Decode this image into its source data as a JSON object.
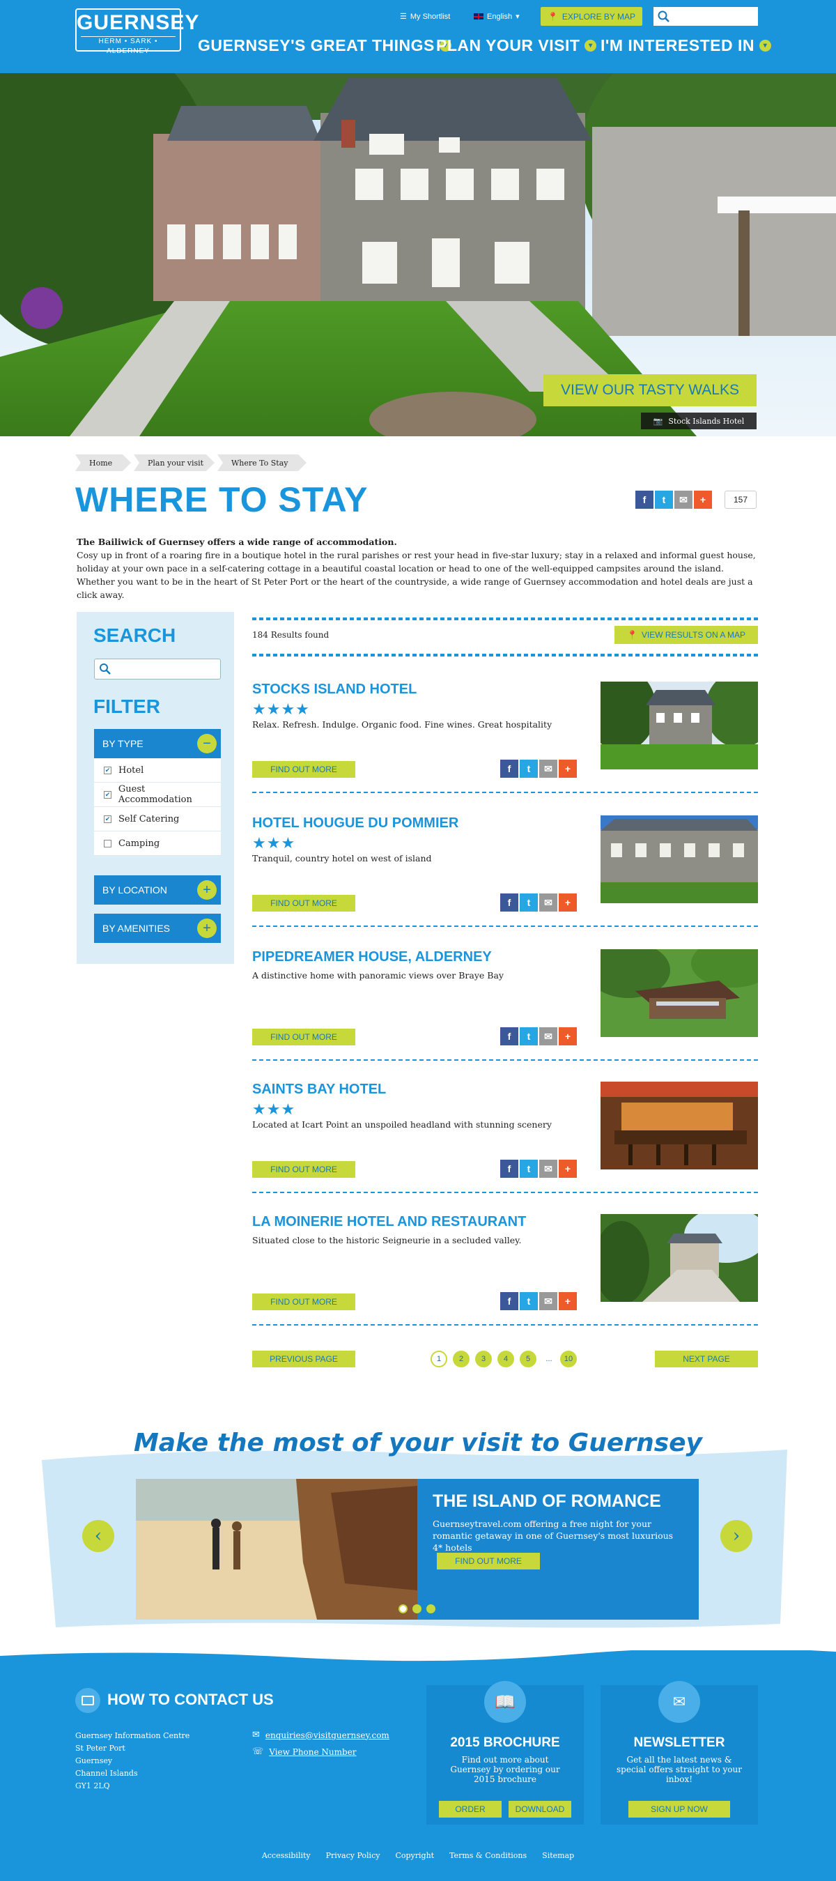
{
  "header": {
    "logo_main": "GUERNSEY",
    "logo_sub": "HERM • SARK • ALDERNEY",
    "shortlist": "My Shortlist",
    "language": "English",
    "explore": "EXPLORE BY MAP",
    "search_placeholder": "",
    "nav": [
      "GUERNSEY'S GREAT THINGS",
      "PLAN YOUR VISIT",
      "I'M INTERESTED IN"
    ]
  },
  "hero": {
    "cta": "VIEW OUR TASTY WALKS",
    "caption": "Stock Islands Hotel"
  },
  "breadcrumb": [
    "Home",
    "Plan your visit",
    "Where To Stay"
  ],
  "page": {
    "title": "WHERE TO STAY",
    "share_count": "157",
    "intro_bold": "The Bailiwick of Guernsey offers a wide range of accommodation.",
    "intro_text": "Cosy up in front of a roaring fire in a boutique hotel in the rural parishes or rest your head in five-star luxury; stay in a relaxed and informal guest house, holiday at your own pace in a self-catering cottage in a beautiful coastal location or head to one of the well-equipped campsites around the island. Whether you want to be in the heart of St Peter Port or the heart of the countryside, a wide range of Guernsey accommodation and hotel deals are just a click away."
  },
  "sidebar": {
    "search_heading": "SEARCH",
    "filter_heading": "FILTER",
    "by_type": "BY TYPE",
    "type_options": [
      {
        "label": "Hotel",
        "checked": true
      },
      {
        "label": "Guest Accommodation",
        "checked": true
      },
      {
        "label": "Self Catering",
        "checked": true
      },
      {
        "label": "Camping",
        "checked": false
      }
    ],
    "by_location": "BY LOCATION",
    "by_amenities": "BY AMENITIES"
  },
  "results": {
    "count_text": "184 Results found",
    "map_button": "VIEW RESULTS ON A MAP",
    "more_label": "FIND OUT MORE",
    "items": [
      {
        "name": "STOCKS ISLAND HOTEL",
        "stars": 4,
        "desc": "Relax. Refresh. Indulge. Organic food. Fine wines. Great hospitality"
      },
      {
        "name": "HOTEL HOUGUE DU POMMIER",
        "stars": 3,
        "desc": "Tranquil, country hotel on west of island"
      },
      {
        "name": "PIPEDREAMER HOUSE, ALDERNEY",
        "stars": 0,
        "desc": "A distinctive home with panoramic views over Braye Bay"
      },
      {
        "name": "SAINTS BAY HOTEL",
        "stars": 3,
        "desc": "Located at Icart Point an unspoiled headland with stunning scenery"
      },
      {
        "name": "LA MOINERIE HOTEL AND RESTAURANT",
        "stars": 0,
        "desc": "Situated close to the historic Seigneurie in a secluded valley."
      }
    ]
  },
  "pagination": {
    "prev": "PREVIOUS PAGE",
    "next": "NEXT PAGE",
    "pages": [
      "1",
      "2",
      "3",
      "4",
      "5",
      "...",
      "10"
    ]
  },
  "promo": {
    "heading": "Make the most of your visit to Guernsey",
    "slide_title": "THE ISLAND OF ROMANCE",
    "slide_text": "Guernseytravel.com offering a free night for your romantic getaway in one of Guernsey's most luxurious 4* hotels",
    "slide_cta": "FIND OUT MORE"
  },
  "footer": {
    "contact_heading": "HOW TO CONTACT US",
    "address": [
      "Guernsey Information Centre",
      "St Peter Port",
      "Guernsey",
      "Channel Islands",
      "GY1 2LQ"
    ],
    "email": "enquiries@visitguernsey.com",
    "phone": "View Phone Number",
    "brochure_title": "2015 BROCHURE",
    "brochure_text": "Find out more about Guernsey by ordering our 2015 brochure",
    "order": "ORDER",
    "download": "DOWNLOAD",
    "newsletter_title": "NEWSLETTER",
    "newsletter_text": "Get all the latest news & special offers straight to your inbox!",
    "signup": "SIGN UP NOW",
    "links": [
      "Accessibility",
      "Privacy Policy",
      "Copyright",
      "Terms & Conditions",
      "Sitemap"
    ]
  },
  "colors": {
    "brand_blue": "#1a95dc",
    "accent_lime": "#c6d83a"
  }
}
